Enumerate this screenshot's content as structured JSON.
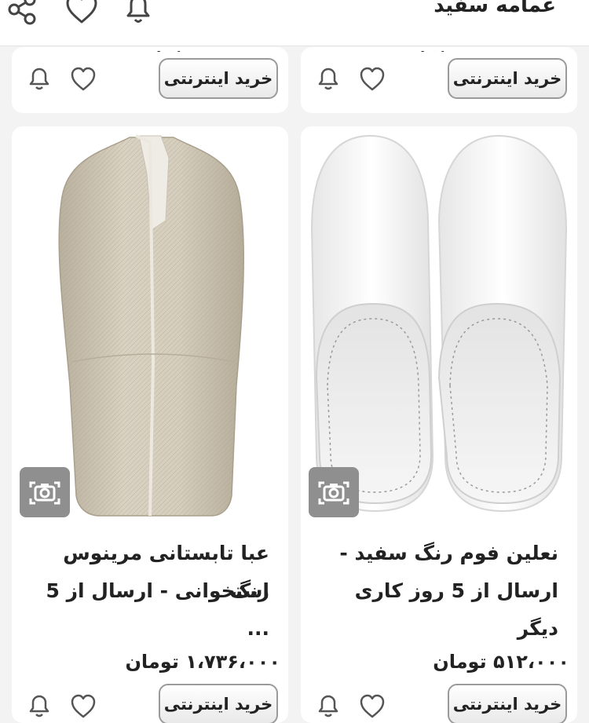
{
  "header": {
    "title": "عمامه سفید"
  },
  "top_row": {
    "buy_label": "خرید اینترنتی"
  },
  "products": [
    {
      "name_line1": "نعلین فوم رنگ سفید -",
      "name_line2": "ارسال از 5 روز کاری دیگر",
      "price": "۵۱۲،۰۰۰ تومان",
      "buy_label": "خرید اینترنتی"
    },
    {
      "name_line1": "عبا تابستانی مرینوس رنگ",
      "name_line2": "استخوانی - ارسال از 5 ...",
      "price": "۱،۷۳۶،۰۰۰ تومان",
      "buy_label": "خرید اینترنتی"
    }
  ],
  "icons": [
    "share-icon",
    "heart-icon",
    "bell-icon",
    "camera-icon"
  ]
}
